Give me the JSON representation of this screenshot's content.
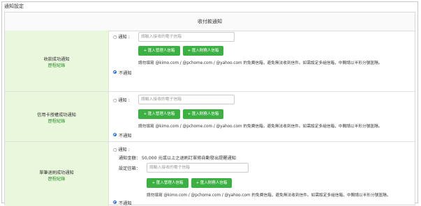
{
  "page_title": "通知設定",
  "section_header": "收付款通知",
  "shared": {
    "notify_option": "○ 通知 :",
    "no_notify_option": "不通知",
    "email_placeholder": "請輸入接收的電子信箱",
    "btn_import_admin": "+ 匯入管理人信箱",
    "btn_import_finance": "+ 匯入財務人信箱",
    "email_note": "請勿填寫 @kimo.com / @pchome.com / @yahoo.com 的免費信箱，避免無法收到信件。如需設定多組信箱，中間請以半形分號區隔。"
  },
  "rows": [
    {
      "title": "收款成功通知",
      "log_link": "歷程紀錄",
      "selected": "no_notify"
    },
    {
      "title": "信用卡授權成功通知",
      "log_link": "歷程紀錄",
      "selected": "no_notify"
    },
    {
      "title": "單筆退刷成功通知",
      "log_link": "歷程紀錄",
      "selected": "no_notify",
      "amount_notice": "通知金額： 50,000 元或以上之退刷訂單將自動發出提醒通知",
      "email_label": "設定信箱："
    }
  ]
}
